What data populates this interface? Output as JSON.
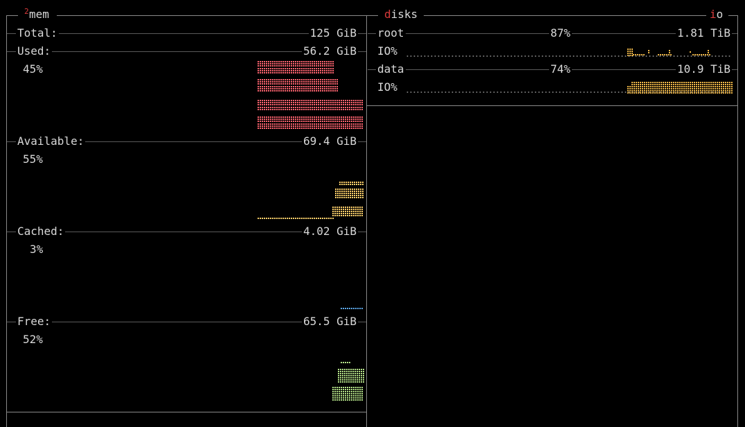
{
  "mem": {
    "box_number": "2",
    "title": "mem",
    "rows": [
      {
        "label": "Total:",
        "value": "125 GiB"
      },
      {
        "label": "Used:",
        "value": "56.2 GiB",
        "percent": "45%",
        "color": "#ff6470"
      },
      {
        "label": "Available:",
        "value": "69.4 GiB",
        "percent": "55%",
        "color": "#ffd16b"
      },
      {
        "label": "Cached:",
        "value": "4.02 GiB",
        "percent": "3%",
        "color": "#5ba7e8"
      },
      {
        "label": "Free:",
        "value": "65.5 GiB",
        "percent": "52%",
        "color": "#b6e48a"
      }
    ]
  },
  "disks": {
    "title_hotkey": "d",
    "title_rest": "isks",
    "io_hotkey": "i",
    "io_rest": "o",
    "items": [
      {
        "name": "root",
        "used_percent": "87%",
        "size": "1.81 TiB",
        "io_label": "IO%"
      },
      {
        "name": "data",
        "used_percent": "74%",
        "size": "10.9 TiB",
        "io_label": "IO%"
      }
    ],
    "io_color": "#f0b848"
  }
}
